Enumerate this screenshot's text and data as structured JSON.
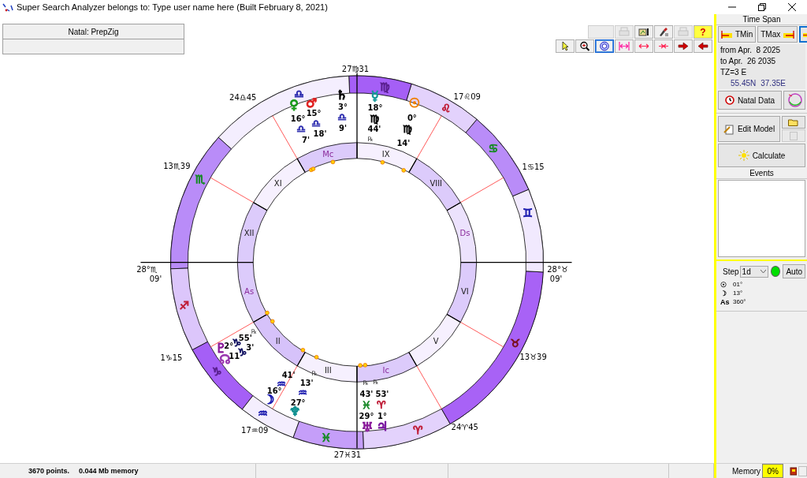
{
  "window": {
    "title": "Super Search Analyzer belongs to: Type user name here (Built February 8, 2021)"
  },
  "chart_header": {
    "label": "Natal: PrepZig"
  },
  "toolbar": [
    {
      "kind": "blank",
      "disabled": true
    },
    {
      "kind": "copy",
      "disabled": true
    },
    {
      "kind": "export",
      "disabled": false
    },
    {
      "kind": "paint",
      "disabled": false
    },
    {
      "kind": "print",
      "disabled": true
    },
    {
      "kind": "help",
      "text": "?",
      "disabled": false
    }
  ],
  "tools": [
    {
      "kind": "pointer",
      "selected": false
    },
    {
      "kind": "zoom",
      "selected": false
    },
    {
      "kind": "ring",
      "selected": true
    },
    {
      "kind": "stretch",
      "selected": false
    },
    {
      "kind": "widen",
      "selected": false
    },
    {
      "kind": "narrow",
      "selected": false
    },
    {
      "kind": "forward",
      "selected": false
    },
    {
      "kind": "back",
      "selected": false
    }
  ],
  "chart": {
    "cusps": [
      "27♍31",
      "24♎45",
      "17♌09",
      "13♏39",
      "1♋15",
      "28°♏",
      "09'",
      "28°♉",
      "09'",
      "1♑15",
      "13♉39",
      "17♒09",
      "24♈45",
      "27♓31"
    ],
    "signs": [
      {
        "glyph": "♈",
        "color": "#c0203a"
      },
      {
        "glyph": "♉",
        "color": "#7a1020"
      },
      {
        "glyph": "♊",
        "color": "#2020b0"
      },
      {
        "glyph": "♋",
        "color": "#1a8a2a"
      },
      {
        "glyph": "♌",
        "color": "#c0203a"
      },
      {
        "glyph": "♍",
        "color": "#5a2090"
      },
      {
        "glyph": "♎",
        "color": "#3030b0"
      },
      {
        "glyph": "♏",
        "color": "#1a8a2a"
      },
      {
        "glyph": "♐",
        "color": "#c0203a"
      },
      {
        "glyph": "♑",
        "color": "#5a2090"
      },
      {
        "glyph": "♒",
        "color": "#2020b0"
      },
      {
        "glyph": "♓",
        "color": "#1a8a2a"
      }
    ],
    "houses": [
      "As",
      "II",
      "III",
      "Ic",
      "V",
      "VI",
      "Ds",
      "VIII",
      "IX",
      "Mc",
      "XI",
      "XII"
    ],
    "planets": [
      {
        "glyph": "♀",
        "color": "#1a9a1a",
        "degree": "16°",
        "sign": {
          "glyph": "♎",
          "color": "#3030b0"
        },
        "minute": "7'"
      },
      {
        "glyph": "♂",
        "color": "#e02020",
        "degree": "15°",
        "sign": {
          "glyph": "♎",
          "color": "#3030b0"
        },
        "minute": "18'"
      },
      {
        "glyph": "♄",
        "color": "#000000",
        "degree": "3°",
        "sign": {
          "glyph": "♎",
          "color": "#3030b0"
        },
        "minute": "9'"
      },
      {
        "glyph": "☿",
        "color": "#189a9a",
        "degree": "18°",
        "sign": {
          "glyph": "♍",
          "color": "#000000"
        },
        "minute": "44'",
        "rx": "℞"
      },
      {
        "glyph": "☉",
        "color": "#f08000",
        "degree": "0°",
        "sign": {
          "glyph": "♍",
          "color": "#000000"
        },
        "minute": "14'"
      },
      {
        "glyph": "♇",
        "color": "#8a1a9a",
        "degree": "2°",
        "sign": {
          "glyph": "♑",
          "color": "#101060"
        },
        "minute": "55'",
        "rx": "℞"
      },
      {
        "glyph": "☊",
        "color": "#9a3ab0",
        "degree": "11",
        "sign": {
          "glyph": "♑",
          "color": "#101060"
        },
        "minute": "3'"
      },
      {
        "glyph": "☽",
        "color": "#1a1ab0",
        "degree": "16°",
        "sign": {
          "glyph": "♒",
          "color": "#2020b0"
        },
        "minute": "41'"
      },
      {
        "glyph": "♆",
        "color": "#109090",
        "degree": "27°",
        "sign": {
          "glyph": "♒",
          "color": "#2020b0"
        },
        "minute": "13'",
        "rx": "℞"
      },
      {
        "glyph": "♅",
        "color": "#8a1a9a",
        "degree": "29°",
        "sign": {
          "glyph": "♓",
          "color": "#1a8a2a"
        },
        "minute": "43'",
        "rx": "℞"
      },
      {
        "glyph": "♃",
        "color": "#7a1aa0",
        "degree": "1°",
        "sign": {
          "glyph": "♈",
          "color": "#c0203a"
        },
        "minute": "53'",
        "rx": "℞"
      }
    ]
  },
  "status_bar": {
    "points": "3670 points.",
    "memory": "0.044 Mb memory"
  },
  "side": {
    "time_span": {
      "title": "Time Span",
      "tmin": "TMin",
      "tmax": "TMax",
      "toggle_selected": true
    },
    "info": {
      "from": "from Apr.  8 2025",
      "to": "to Apr.  26 2035",
      "tz": "TZ=3 E",
      "lat": "55.45N",
      "lon": "37.35E"
    },
    "natal_button": "Natal Data",
    "edit_button": "Edit Model",
    "save_disabled": true,
    "calculate_button": "Calculate",
    "events_title": "Events",
    "step": {
      "label": "Step",
      "value": "1d",
      "running": true,
      "auto": "Auto"
    },
    "readouts": [
      {
        "symbol": "☉",
        "value": "01°"
      },
      {
        "symbol": "☽",
        "value": "13°"
      },
      {
        "symbol": "As",
        "value": "360°"
      }
    ],
    "memory": {
      "label": "Memory",
      "value": "0%"
    },
    "check_disabled": true
  }
}
